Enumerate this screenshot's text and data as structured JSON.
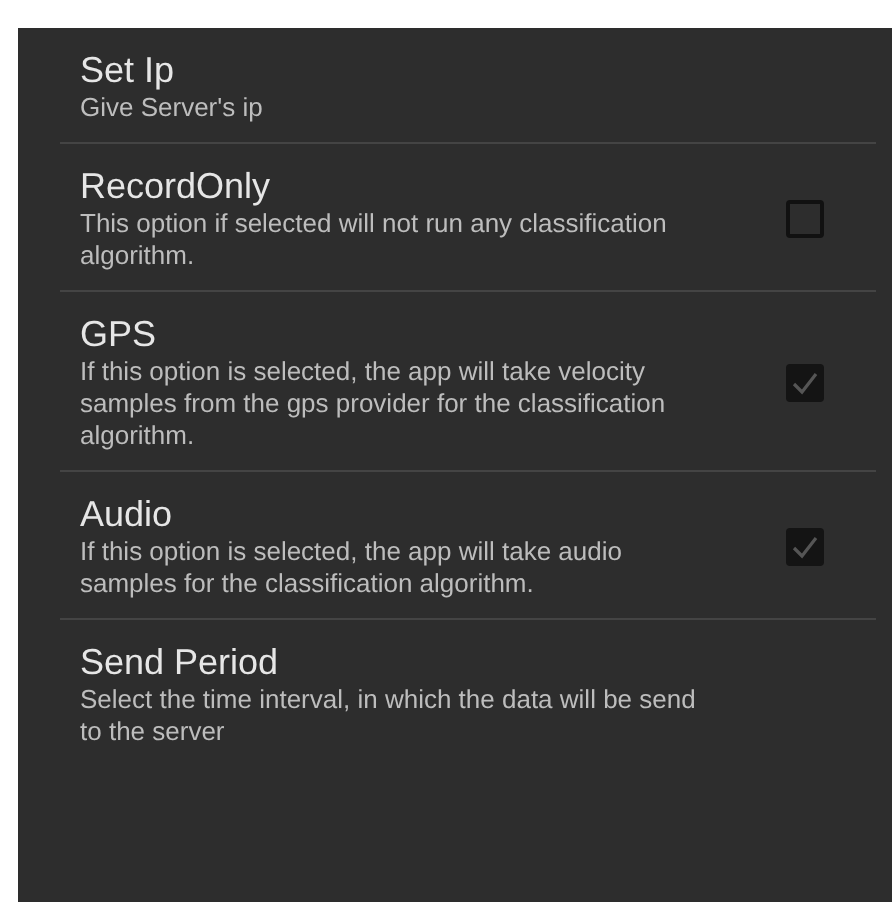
{
  "preferences": [
    {
      "kind": "text",
      "title": "Set Ip",
      "summary": "Give Server's ip"
    },
    {
      "kind": "checkbox",
      "title": "RecordOnly",
      "summary": "This option if selected will not run any classification algorithm.",
      "checked": false
    },
    {
      "kind": "checkbox",
      "title": "GPS",
      "summary": "If this option is selected, the app will take velocity samples from the gps provider for the classification algorithm.",
      "checked": true
    },
    {
      "kind": "checkbox",
      "title": "Audio",
      "summary": "If this option is selected, the app will take audio samples for the classification algorithm.",
      "checked": true
    },
    {
      "kind": "text",
      "title": "Send Period",
      "summary": "Select the time interval, in which the data will be send to the server"
    }
  ]
}
